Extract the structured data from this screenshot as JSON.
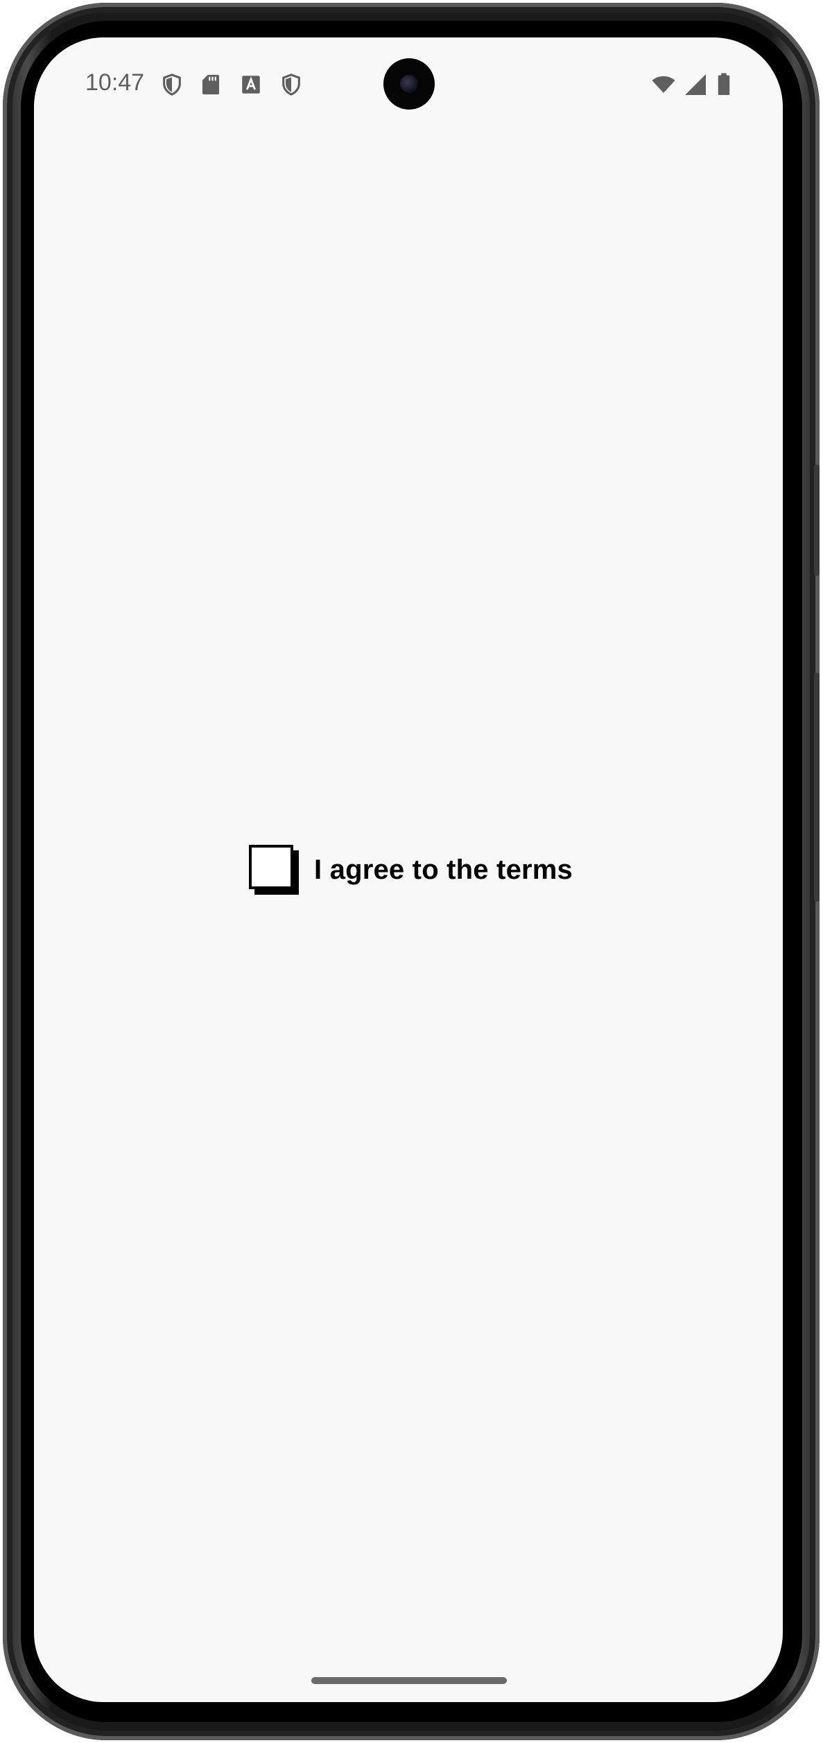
{
  "status_bar": {
    "time": "10:47",
    "left_icons": [
      "shield-icon",
      "sd-card-icon",
      "font-a-icon",
      "shield-icon"
    ],
    "right_icons": [
      "wifi-icon",
      "cellular-signal-icon",
      "battery-icon"
    ],
    "icon_color": "#5f5f5f"
  },
  "content": {
    "checkbox": {
      "checked": false,
      "label": "I agree to the terms"
    }
  },
  "colors": {
    "background": "#f8f8f8",
    "text": "#000000"
  }
}
